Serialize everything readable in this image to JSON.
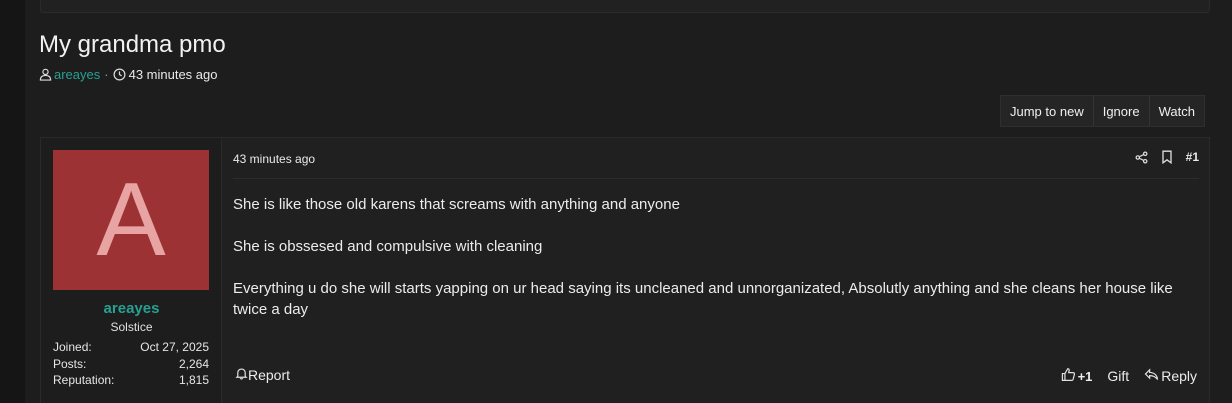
{
  "thread": {
    "title": "My grandma pmo",
    "author": "areayes",
    "time": "43 minutes ago"
  },
  "actions": {
    "jump": "Jump to new",
    "ignore": "Ignore",
    "watch": "Watch"
  },
  "post": {
    "avatar_letter": "A",
    "username": "areayes",
    "user_title": "Solstice",
    "stats": [
      {
        "label": "Joined:",
        "value": "Oct 27, 2025"
      },
      {
        "label": "Posts:",
        "value": "2,264"
      },
      {
        "label": "Reputation:",
        "value": "1,815"
      }
    ],
    "time": "43 minutes ago",
    "number": "#1",
    "paragraphs": [
      "She is like those old karens that screams with anything and anyone",
      "She is obssesed and compulsive with cleaning",
      "Everything u do she will starts yapping on ur head saying its uncleaned and unnorganizated, Absolutly anything and she cleans her house like twice a day"
    ],
    "report": "Report",
    "reaction_count": "+1",
    "gift": "Gift",
    "reply": "Reply"
  },
  "colors": {
    "accent": "#27a092",
    "avatar_bg": "#9c3234",
    "avatar_letter": "#e8a3a3",
    "background": "#1d1d1d"
  }
}
